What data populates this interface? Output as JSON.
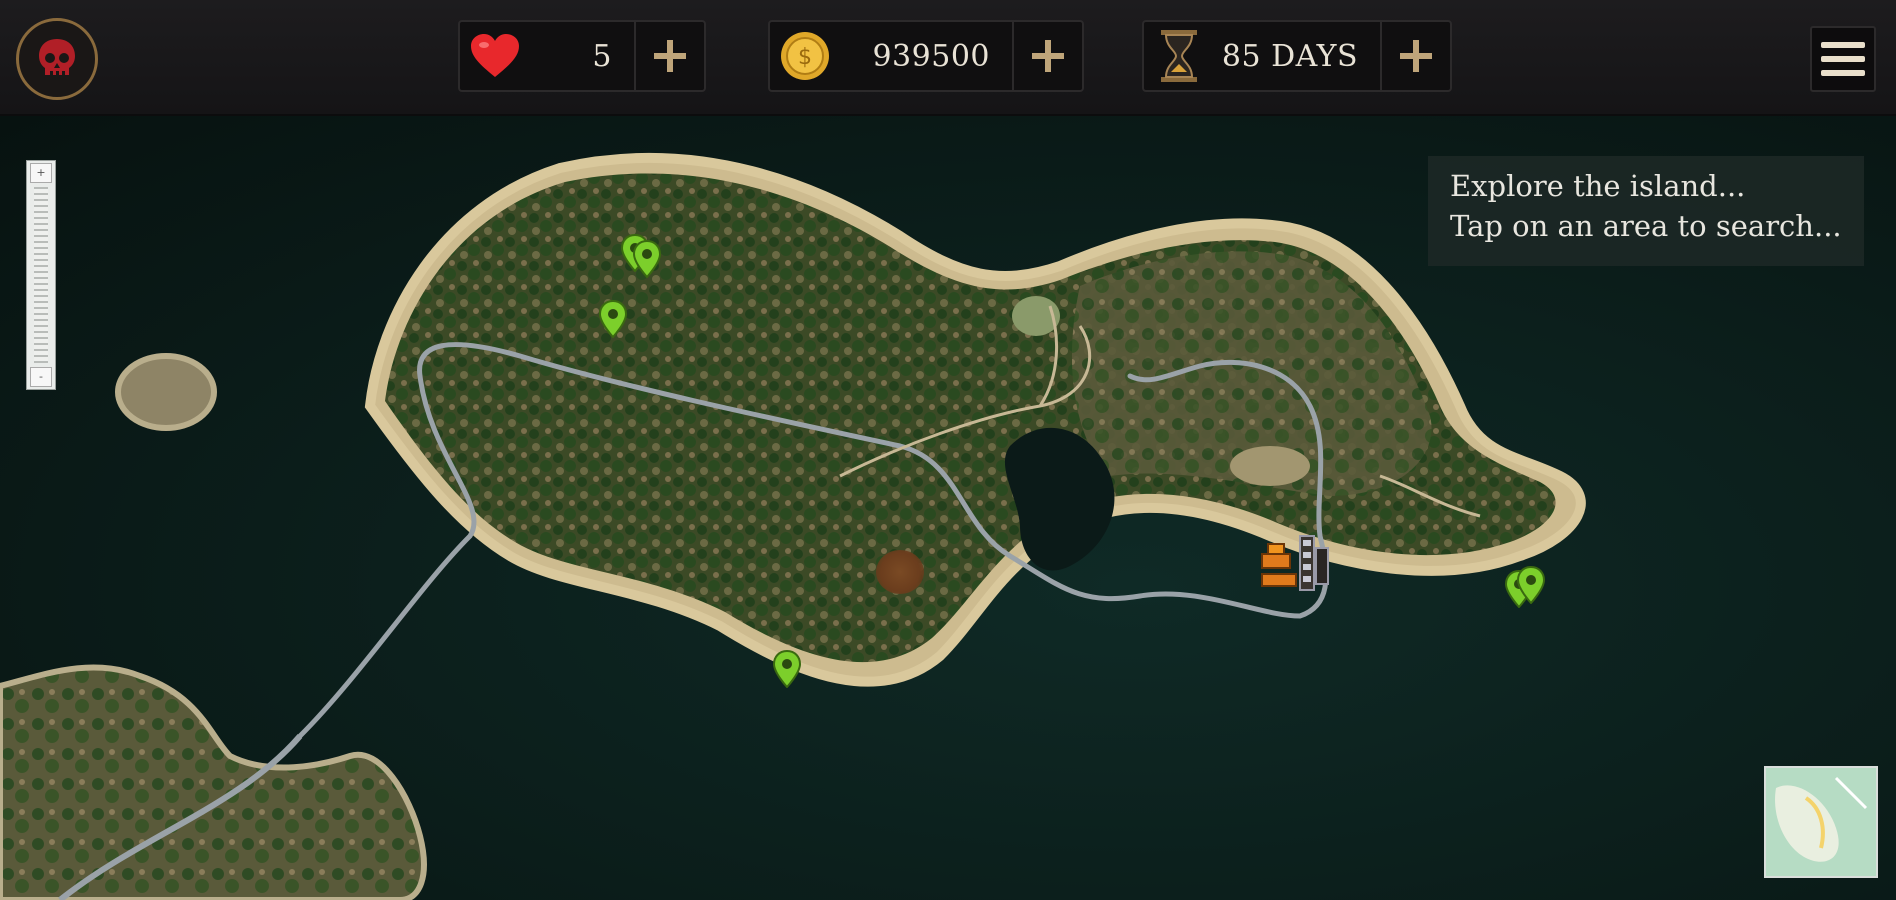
{
  "hud": {
    "skull_icon": "skull-icon",
    "lives": {
      "icon": "heart-icon",
      "value": "5",
      "plus_icon": "plus-icon"
    },
    "coins": {
      "icon": "coin-icon",
      "value": "939500",
      "plus_icon": "plus-icon"
    },
    "days": {
      "icon": "hourglass-icon",
      "value": "85 DAYS",
      "plus_icon": "plus-icon"
    },
    "menu_icon": "hamburger-menu-icon"
  },
  "map": {
    "hint_line1": "Explore the island...",
    "hint_line2": "Tap on an area to search...",
    "zoom": {
      "plus": "+",
      "minus": "-"
    }
  },
  "colors": {
    "hud_bg": "#1d1c1e",
    "pin_green": "#7ccf2b",
    "skull_red": "#c0202a",
    "gold": "#d9a23a",
    "plus_tan": "#bfa57a",
    "water": "#0b1d1a"
  }
}
